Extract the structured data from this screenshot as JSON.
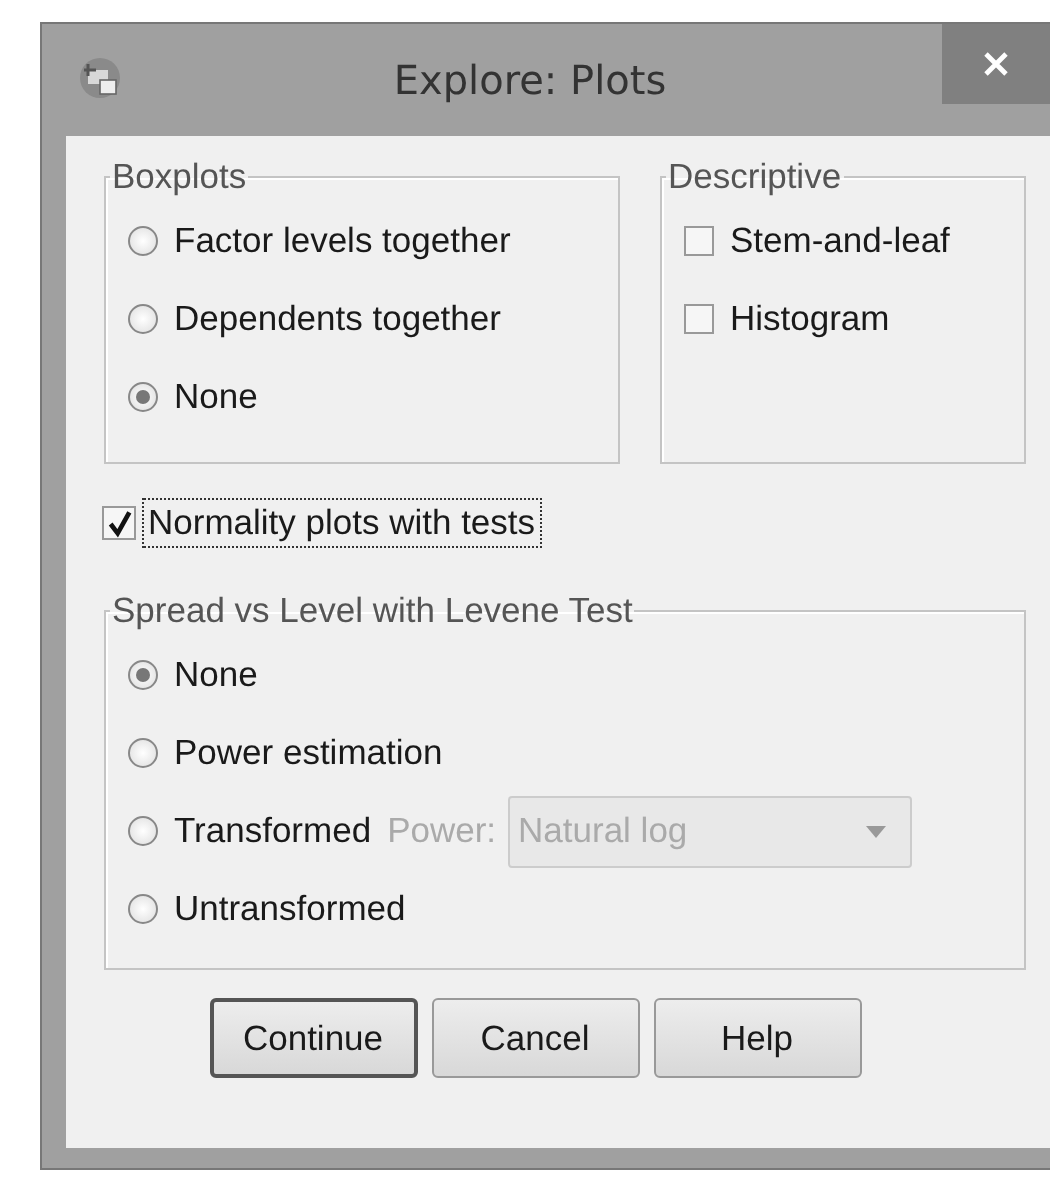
{
  "window": {
    "title": "Explore: Plots"
  },
  "boxplots": {
    "title": "Boxplots",
    "options": [
      {
        "label": "Factor levels together",
        "selected": false
      },
      {
        "label": "Dependents together",
        "selected": false
      },
      {
        "label": "None",
        "selected": true
      }
    ]
  },
  "descriptive": {
    "title": "Descriptive",
    "options": [
      {
        "label": "Stem-and-leaf",
        "checked": false
      },
      {
        "label": "Histogram",
        "checked": false
      }
    ]
  },
  "normality": {
    "label": "Normality plots with tests",
    "checked": true,
    "focused": true
  },
  "spread": {
    "title": "Spread vs Level with Levene Test",
    "options": [
      {
        "label": "None",
        "selected": true
      },
      {
        "label": "Power estimation",
        "selected": false
      },
      {
        "label": "Transformed",
        "selected": false,
        "power": {
          "label": "Power:",
          "value": "Natural log",
          "disabled": true
        }
      },
      {
        "label": "Untransformed",
        "selected": false
      }
    ]
  },
  "buttons": [
    {
      "label": "Continue",
      "default": true
    },
    {
      "label": "Cancel",
      "default": false
    },
    {
      "label": "Help",
      "default": false
    }
  ]
}
